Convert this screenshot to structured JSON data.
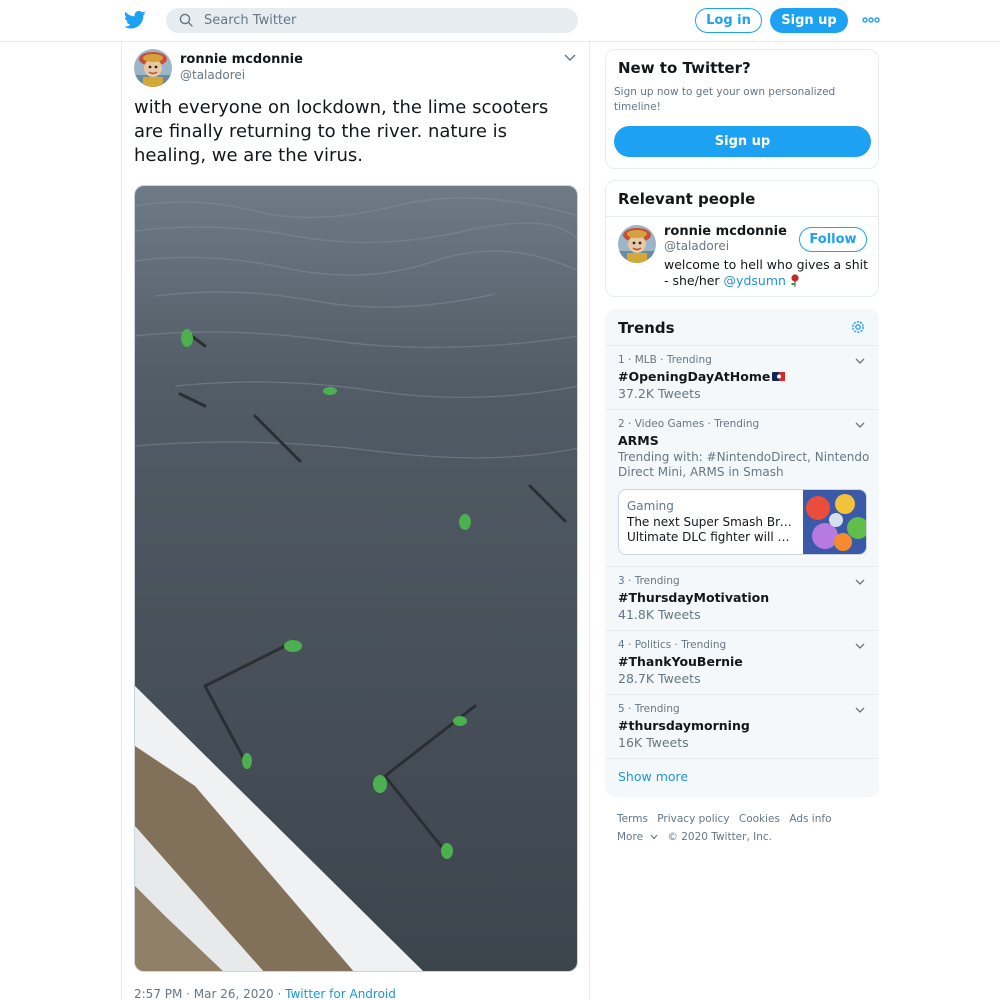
{
  "header": {
    "search_placeholder": "Search Twitter",
    "login_label": "Log in",
    "signup_label": "Sign up",
    "brand_color": "#1da1f2",
    "icons": [
      "twitter-logo-icon",
      "search-icon",
      "more-icon"
    ]
  },
  "tweet": {
    "author_name": "ronnie mcdonnie",
    "author_handle": "@taladorei",
    "text": "with everyone on lockdown, the lime scooters are finally returning to the river. nature is healing, we are the virus.",
    "timestamp": "2:57 PM · Mar 26, 2020 · ",
    "source": "Twitter for Android"
  },
  "sidebar": {
    "new_to_twitter": {
      "title": "New to Twitter?",
      "description": "Sign up now to get your own personalized timeline!",
      "signup_label": "Sign up"
    },
    "relevant_people": {
      "title": "Relevant people",
      "name": "ronnie mcdonnie",
      "handle": "@taladorei",
      "follow_label": "Follow",
      "bio": "welcome to hell who gives a shit - she/her ",
      "bio_mention": "@ydsumn"
    },
    "trends": {
      "title": "Trends",
      "items": [
        {
          "meta": "1 · MLB · Trending",
          "name": "#OpeningDayAtHome",
          "count": "37.2K Tweets"
        },
        {
          "meta": "2 · Video Games · Trending",
          "name": "ARMS",
          "with": "Trending with: #NintendoDirect, Nintendo Direct Mini, ARMS in Smash"
        },
        {
          "meta": "3 · Trending",
          "name": "#ThursdayMotivation",
          "count": "41.8K Tweets"
        },
        {
          "meta": "4 · Politics · Trending",
          "name": "#ThankYouBernie",
          "count": "28.7K Tweets"
        },
        {
          "meta": "5 · Trending",
          "name": "#thursdaymorning",
          "count": "16K Tweets"
        }
      ],
      "news": {
        "category": "Gaming",
        "line1": "The next Super Smash Bros.",
        "line2": "Ultimate DLC fighter will b…"
      },
      "show_more": "Show more"
    },
    "footer": {
      "links": [
        "Terms",
        "Privacy policy",
        "Cookies",
        "Ads info"
      ],
      "more": "More",
      "copyright": "© 2020 Twitter, Inc."
    }
  }
}
